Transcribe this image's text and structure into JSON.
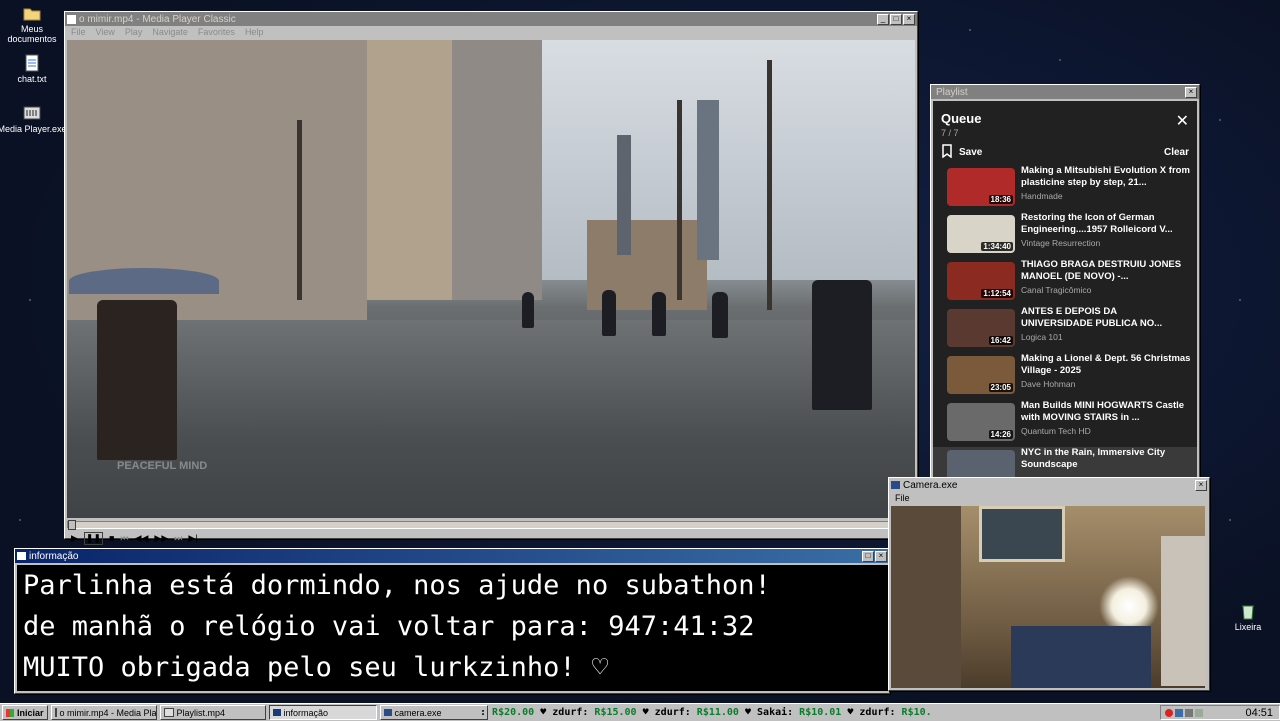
{
  "desktop": {
    "icons": [
      {
        "label": "Meus documentos",
        "icon": "folder-icon"
      },
      {
        "label": "chat.txt",
        "icon": "notepad-icon"
      },
      {
        "label": "Media Player.exe",
        "icon": "media-player-icon"
      },
      {
        "label": "Lixeira",
        "icon": "recycle-bin-icon"
      }
    ]
  },
  "media_player": {
    "title": "o mimir.mp4 - Media Player Classic",
    "menu": [
      "File",
      "View",
      "Play",
      "Navigate",
      "Favorites",
      "Help"
    ],
    "watermark": "PEACEFUL MIND"
  },
  "playlist_window": {
    "title": "Playlist",
    "queue_title": "Queue",
    "count": "7 / 7",
    "save_label": "Save",
    "clear_label": "Clear",
    "items": [
      {
        "title": "Making a Mitsubishi Evolution X from plasticine step by step, 21...",
        "channel": "Handmade",
        "duration": "18:36",
        "thumb_color": "#b02a2a"
      },
      {
        "title": "Restoring the Icon of German Engineering....1957 Rolleicord V...",
        "channel": "Vintage Resurrection",
        "duration": "1:34:40",
        "thumb_color": "#d9d4c8"
      },
      {
        "title": "THIAGO BRAGA DESTRUIU JONES MANOEL (DE NOVO) -...",
        "channel": "Canal Tragicômico",
        "duration": "1:12:54",
        "thumb_color": "#8a2a20"
      },
      {
        "title": "ANTES E DEPOIS DA UNIVERSIDADE PUBLICA NO...",
        "channel": "Logica 101",
        "duration": "16:42",
        "thumb_color": "#5a3a30"
      },
      {
        "title": "Making a Lionel & Dept. 56 Christmas Village - 2025",
        "channel": "Dave Hohman",
        "duration": "23:05",
        "thumb_color": "#7a5a3a"
      },
      {
        "title": "Man Builds MINI HOGWARTS Castle with MOVING STAIRS in ...",
        "channel": "Quantum Tech HD",
        "duration": "14:26",
        "thumb_color": "#6a6a6a"
      },
      {
        "title": "NYC in the Rain, Immersive City Soundscape",
        "channel": "",
        "duration": "",
        "thumb_color": "#5a6270"
      }
    ]
  },
  "info_window": {
    "title": "informação",
    "lines": [
      "Parlinha está dormindo, nos ajude no subathon!",
      "de manhã o relógio vai voltar para:  947:41:32",
      "MUITO obrigada pelo seu lurkzinho! ♡"
    ]
  },
  "camera_window": {
    "title": "Camera.exe",
    "menu_file": "File"
  },
  "taskbar": {
    "start_label": "Iniciar",
    "tasks": [
      "o mimir.mp4 - Media Playe...",
      "Playlist.mp4",
      "informação",
      "camera.exe"
    ],
    "ticker": [
      {
        "prefix": ": ",
        "money": "R$20.00"
      },
      {
        "prefix": " ♥ zdurf: ",
        "money": "R$15.00"
      },
      {
        "prefix": " ♥ zdurf: ",
        "money": "R$11.00"
      },
      {
        "prefix": " ♥ Sakai: ",
        "money": "R$10.01"
      },
      {
        "prefix": " ♥ zdurf: ",
        "money": "R$10."
      }
    ],
    "clock": "04:51"
  }
}
